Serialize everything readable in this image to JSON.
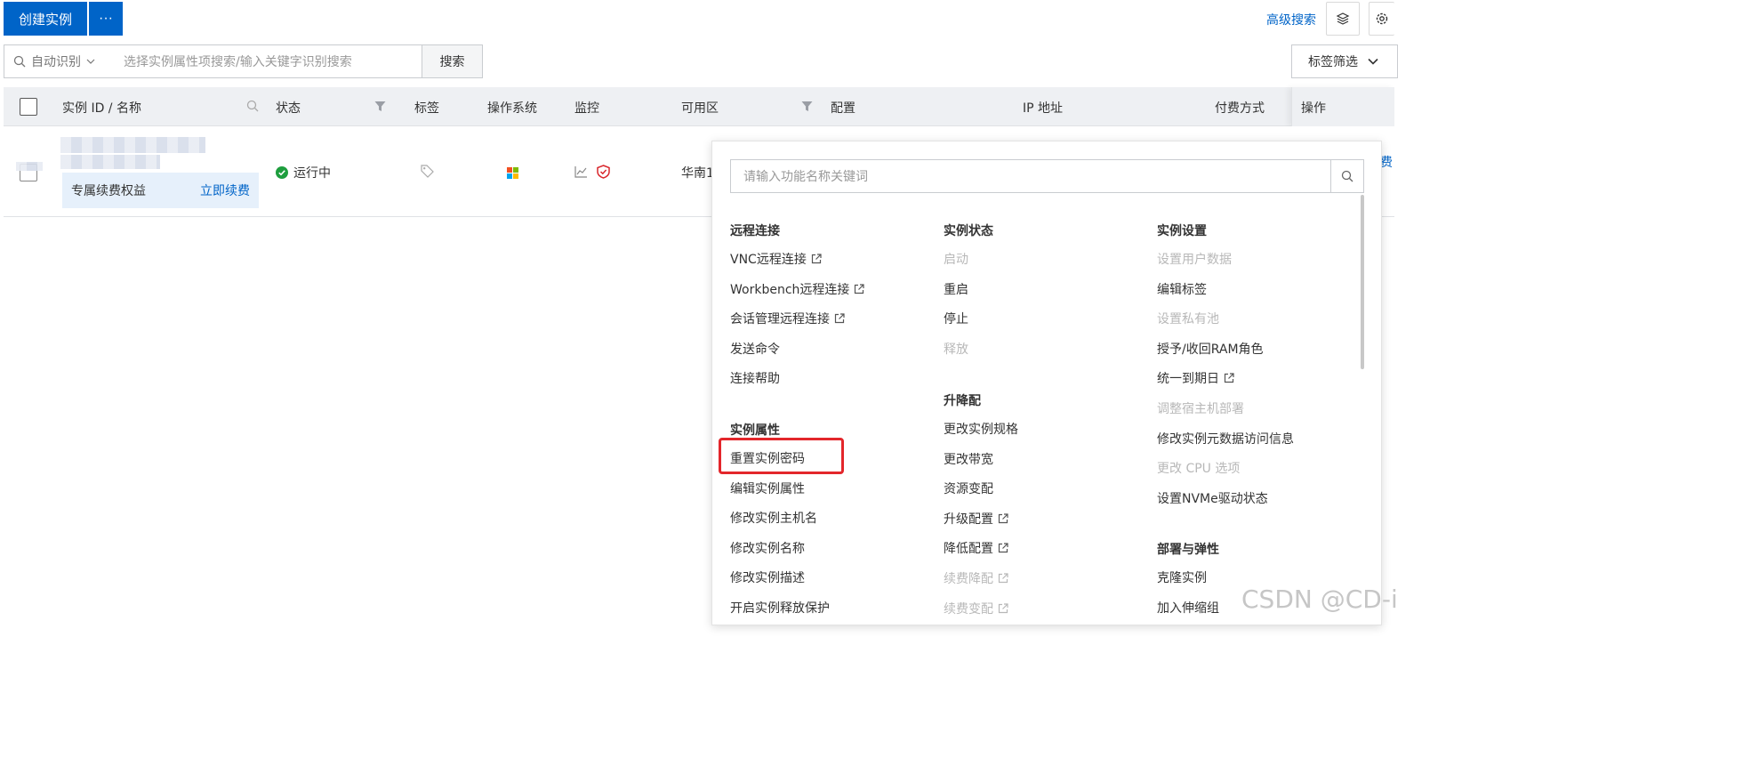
{
  "toolbar": {
    "create_label": "创建实例",
    "more_label": "···",
    "advanced_search": "高级搜索"
  },
  "search": {
    "mode": "自动识别",
    "placeholder": "选择实例属性项搜索/输入关键字识别搜索",
    "button": "搜索",
    "tag_filter": "标签筛选"
  },
  "table": {
    "headers": {
      "id_name": "实例 ID / 名称",
      "status": "状态",
      "tags": "标签",
      "os": "操作系统",
      "monitor": "监控",
      "zone": "可用区",
      "config": "配置",
      "ip": "IP 地址",
      "billing": "付费方式",
      "ops": "操作"
    },
    "row": {
      "status": "运行中",
      "zone": "华南1",
      "renew_label": "专属续费权益",
      "renew_link": "立即续费",
      "ops_partial": "费"
    }
  },
  "panel": {
    "search_placeholder": "请输入功能名称关键词",
    "col1": {
      "group1": {
        "title": "远程连接",
        "items": [
          {
            "label": "VNC远程连接",
            "external": true,
            "disabled": false
          },
          {
            "label": "Workbench远程连接",
            "external": true,
            "disabled": false
          },
          {
            "label": "会话管理远程连接",
            "external": true,
            "disabled": false
          },
          {
            "label": "发送命令",
            "external": false,
            "disabled": false
          },
          {
            "label": "连接帮助",
            "external": false,
            "disabled": false
          }
        ]
      },
      "group2": {
        "title": "实例属性",
        "items": [
          {
            "label": "重置实例密码",
            "external": false,
            "disabled": false
          },
          {
            "label": "编辑实例属性",
            "external": false,
            "disabled": false
          },
          {
            "label": "修改实例主机名",
            "external": false,
            "disabled": false
          },
          {
            "label": "修改实例名称",
            "external": false,
            "disabled": false
          },
          {
            "label": "修改实例描述",
            "external": false,
            "disabled": false
          },
          {
            "label": "开启实例释放保护",
            "external": false,
            "disabled": false
          }
        ]
      }
    },
    "col2": {
      "group1": {
        "title": "实例状态",
        "items": [
          {
            "label": "启动",
            "external": false,
            "disabled": true
          },
          {
            "label": "重启",
            "external": false,
            "disabled": false
          },
          {
            "label": "停止",
            "external": false,
            "disabled": false
          },
          {
            "label": "释放",
            "external": false,
            "disabled": true
          }
        ]
      },
      "group2": {
        "title": "升降配",
        "items": [
          {
            "label": "更改实例规格",
            "external": false,
            "disabled": false
          },
          {
            "label": "更改带宽",
            "external": false,
            "disabled": false
          },
          {
            "label": "资源变配",
            "external": false,
            "disabled": false
          },
          {
            "label": "升级配置",
            "external": true,
            "disabled": false
          },
          {
            "label": "降低配置",
            "external": true,
            "disabled": false
          },
          {
            "label": "续费降配",
            "external": true,
            "disabled": true
          },
          {
            "label": "续费变配",
            "external": true,
            "disabled": true
          }
        ]
      }
    },
    "col3": {
      "group1": {
        "title": "实例设置",
        "items": [
          {
            "label": "设置用户数据",
            "external": false,
            "disabled": true
          },
          {
            "label": "编辑标签",
            "external": false,
            "disabled": false
          },
          {
            "label": "设置私有池",
            "external": false,
            "disabled": true
          },
          {
            "label": "授予/收回RAM角色",
            "external": false,
            "disabled": false
          },
          {
            "label": "统一到期日",
            "external": true,
            "disabled": false
          },
          {
            "label": "调整宿主机部署",
            "external": false,
            "disabled": true
          },
          {
            "label": "修改实例元数据访问信息",
            "external": false,
            "disabled": false
          },
          {
            "label": "更改 CPU 选项",
            "external": false,
            "disabled": true
          },
          {
            "label": "设置NVMe驱动状态",
            "external": false,
            "disabled": false
          }
        ]
      },
      "group2": {
        "title": "部署与弹性",
        "items": [
          {
            "label": "克隆实例",
            "external": false,
            "disabled": false
          },
          {
            "label": "加入伸缩组",
            "external": false,
            "disabled": false
          }
        ]
      }
    }
  },
  "watermark": "CSDN @CD-i",
  "colors": {
    "primary": "#0064c8",
    "success": "#1e9e3e",
    "highlight": "#e3262b",
    "disabled": "#b8b8b8"
  }
}
